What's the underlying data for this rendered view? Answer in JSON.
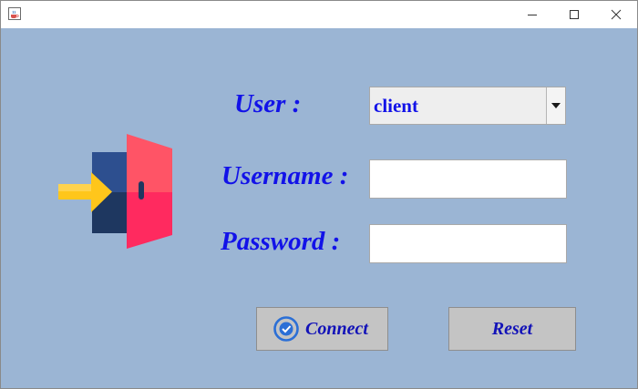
{
  "window": {
    "icon": "java-cup-icon",
    "controls": {
      "minimize_icon": "minimize-icon",
      "maximize_icon": "maximize-icon",
      "close_icon": "close-icon"
    }
  },
  "form": {
    "user_label": "User :",
    "user_select": {
      "selected": "client",
      "icon": "chevron-down-icon"
    },
    "username_label": "Username :",
    "username_value": "",
    "password_label": "Password :",
    "password_value": ""
  },
  "actions": {
    "connect_label": "Connect",
    "connect_icon": "check-circle-icon",
    "reset_label": "Reset"
  },
  "illustration": {
    "icon": "login-door-arrow-icon"
  },
  "colors": {
    "background": "#9bb5d4",
    "label_text": "#1212e8",
    "button_bg": "#c4c4c4",
    "door_red": "#ff2a5f",
    "door_dark": "#1e3760",
    "arrow_yellow": "#ffc61b"
  }
}
